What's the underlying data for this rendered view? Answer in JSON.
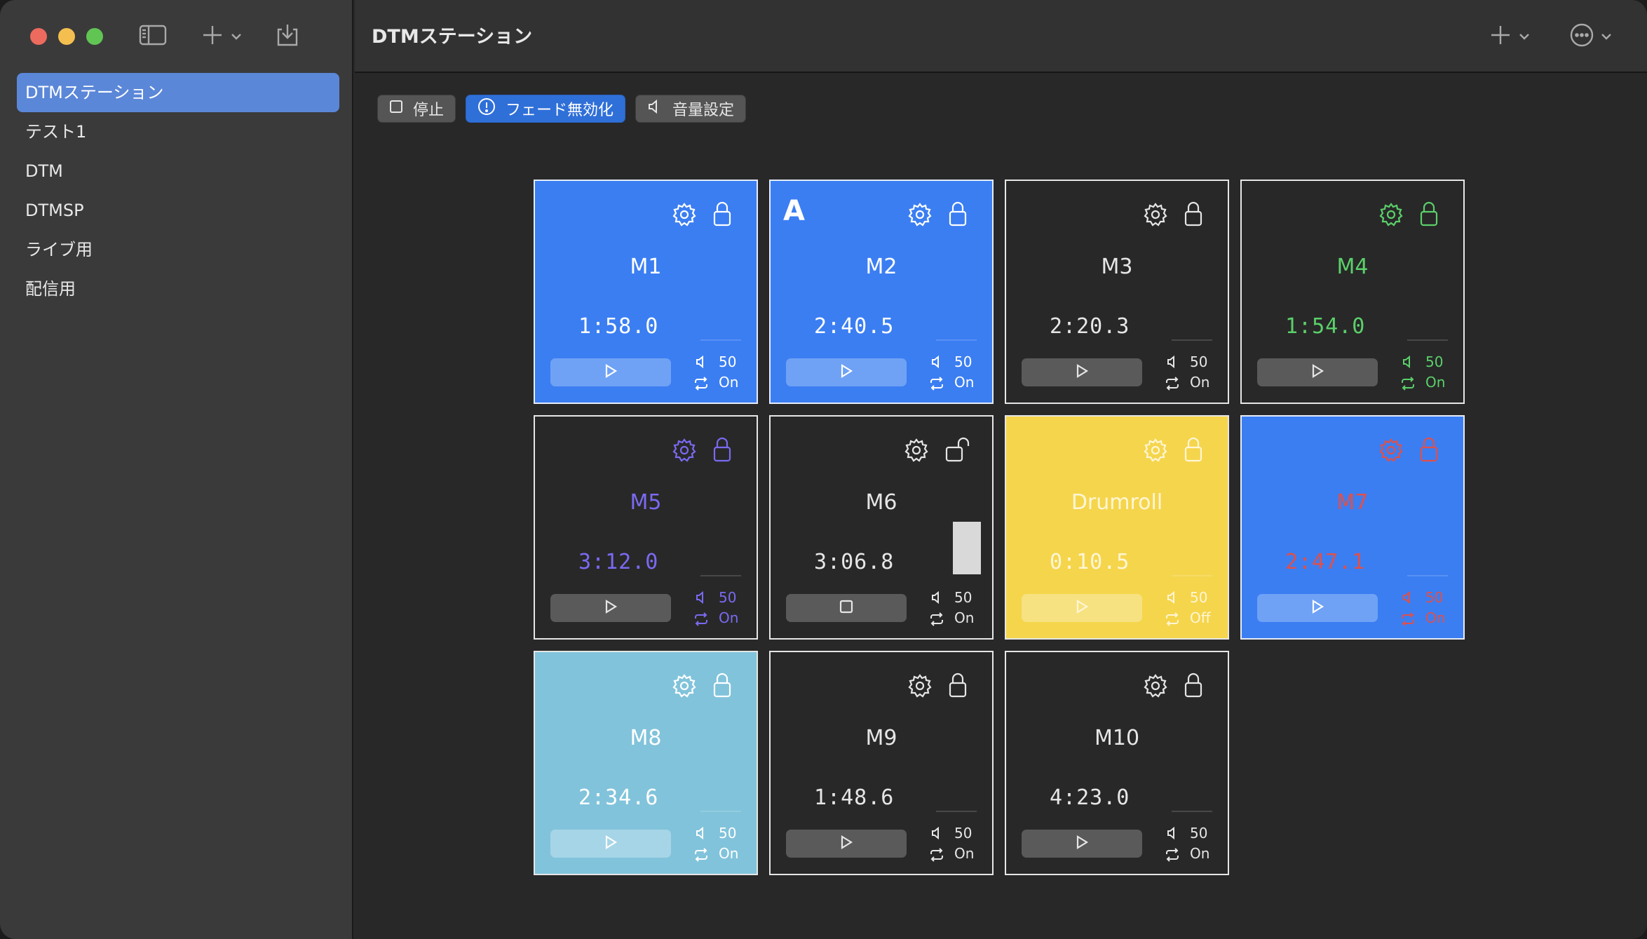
{
  "sidebar": {
    "items": [
      {
        "label": "DTMステーション",
        "selected": true
      },
      {
        "label": "テスト1",
        "selected": false
      },
      {
        "label": "DTM",
        "selected": false
      },
      {
        "label": "DTMSP",
        "selected": false
      },
      {
        "label": "ライブ用",
        "selected": false
      },
      {
        "label": "配信用",
        "selected": false
      }
    ]
  },
  "window": {
    "title": "DTMステーション"
  },
  "toolbar": {
    "stop_label": "停止",
    "fade_label": "フェード無効化",
    "volume_label": "音量設定"
  },
  "tiles": [
    {
      "name": "M1",
      "time": "1:58.0",
      "volume": "50",
      "loop": "On",
      "style": "blue",
      "lock": "locked",
      "letter": "",
      "playing": false
    },
    {
      "name": "M2",
      "time": "2:40.5",
      "volume": "50",
      "loop": "On",
      "style": "blue",
      "lock": "locked",
      "letter": "A",
      "playing": false
    },
    {
      "name": "M3",
      "time": "2:20.3",
      "volume": "50",
      "loop": "On",
      "style": "dark",
      "lock": "locked",
      "letter": "",
      "playing": false
    },
    {
      "name": "M4",
      "time": "1:54.0",
      "volume": "50",
      "loop": "On",
      "style": "dark",
      "text_color": "#5bd06a",
      "lock": "locked",
      "letter": "",
      "playing": false
    },
    {
      "name": "M5",
      "time": "3:12.0",
      "volume": "50",
      "loop": "On",
      "style": "dark",
      "text_color": "#7a6af2",
      "lock": "locked",
      "letter": "",
      "playing": false
    },
    {
      "name": "M6",
      "time": "3:06.8",
      "volume": "50",
      "loop": "On",
      "style": "dark",
      "lock": "unlocked",
      "letter": "",
      "playing": true
    },
    {
      "name": "Drumroll",
      "time": "0:10.5",
      "volume": "50",
      "loop": "Off",
      "style": "yellow",
      "lock": "locked",
      "letter": "",
      "playing": false
    },
    {
      "name": "M7",
      "time": "2:47.1",
      "volume": "50",
      "loop": "On",
      "style": "blue",
      "text_color": "#e0504a",
      "lock": "locked",
      "letter": "",
      "playing": false
    },
    {
      "name": "M8",
      "time": "2:34.6",
      "volume": "50",
      "loop": "On",
      "style": "cyan",
      "lock": "locked",
      "letter": "",
      "playing": false
    },
    {
      "name": "M9",
      "time": "1:48.6",
      "volume": "50",
      "loop": "On",
      "style": "dark",
      "lock": "locked",
      "letter": "",
      "playing": false
    },
    {
      "name": "M10",
      "time": "4:23.0",
      "volume": "50",
      "loop": "On",
      "style": "dark",
      "lock": "locked",
      "letter": "",
      "playing": false
    }
  ],
  "icons": {
    "sidebar_toggle": "sidebar-icon",
    "add": "plus-icon",
    "import": "tray-download-icon",
    "more": "ellipsis-circle-icon",
    "tile_settings": "gear-icon",
    "tile_lock": "lock-icon",
    "tile_unlock": "lock-open-icon",
    "play": "play-icon",
    "stop": "stop-icon",
    "volume": "speaker-icon",
    "loop": "repeat-icon"
  },
  "colors": {
    "accent": "#3b7ef2",
    "sidebar_selection": "#5b87d8",
    "drumroll": "#f5d54c",
    "m8": "#81c3db"
  }
}
